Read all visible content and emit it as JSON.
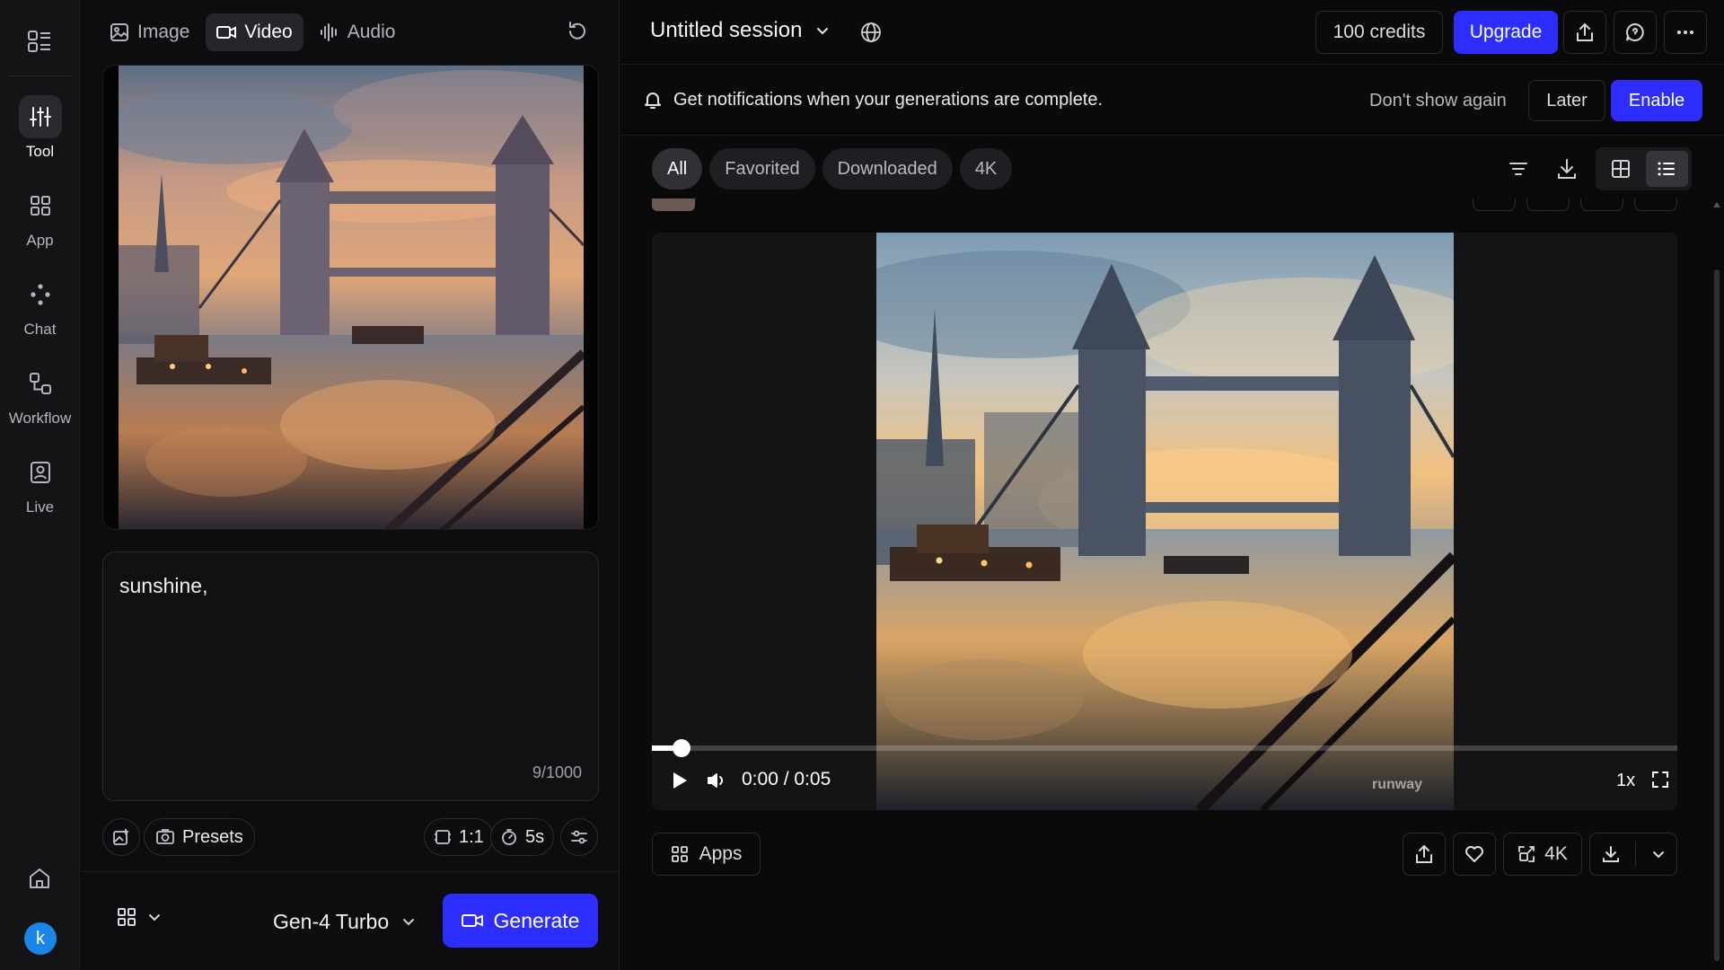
{
  "rail": {
    "items": [
      {
        "label": "Tool",
        "active": true
      },
      {
        "label": "App"
      },
      {
        "label": "Chat"
      },
      {
        "label": "Workflow"
      },
      {
        "label": "Live"
      }
    ],
    "avatar_letter": "k",
    "avatar_color": "#1c86e8"
  },
  "panel": {
    "modes": [
      {
        "label": "Image",
        "icon": "image-icon"
      },
      {
        "label": "Video",
        "icon": "video-camera-icon",
        "active": true
      },
      {
        "label": "Audio",
        "icon": "audio-waveform-icon"
      }
    ],
    "prompt": {
      "text": "sunshine,",
      "char_count": "9/1000"
    },
    "chips": {
      "presets": "Presets",
      "ratio": "1:1",
      "duration": "5s"
    },
    "model": "Gen-4 Turbo",
    "generate_label": "Generate"
  },
  "topbar": {
    "session_title": "Untitled session",
    "credits": "100 credits",
    "upgrade": "Upgrade"
  },
  "notification": {
    "text": "Get notifications when your generations are complete.",
    "dont_show": "Don't show again",
    "later": "Later",
    "enable": "Enable"
  },
  "filters": [
    {
      "label": "All",
      "active": true
    },
    {
      "label": "Favorited"
    },
    {
      "label": "Downloaded"
    },
    {
      "label": "4K"
    }
  ],
  "player": {
    "time": "0:00 / 0:05",
    "progress": 0.02,
    "speed": "1x",
    "watermark": "runway"
  },
  "actions": {
    "apps": "Apps",
    "upscale": "4K"
  },
  "colors": {
    "accent": "#2d2dff",
    "background": "#0a0a0b",
    "panel": "#0d0d0f"
  }
}
